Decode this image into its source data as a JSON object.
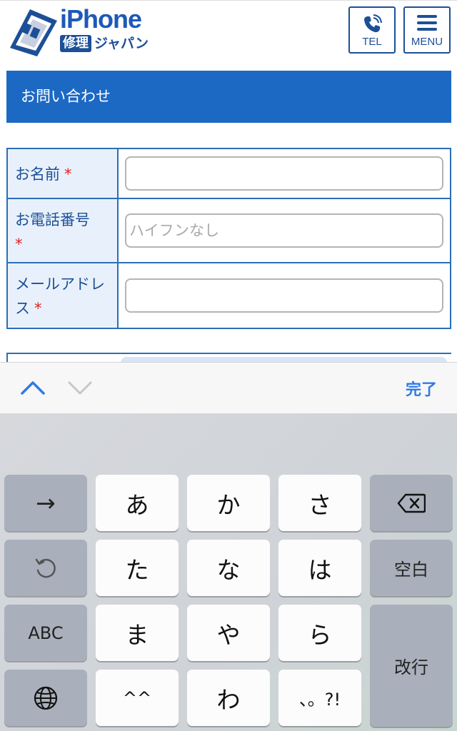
{
  "header": {
    "brand_name": "iPhone",
    "brand_badge": "修理",
    "brand_sub": "ジャパン",
    "tel_label": "TEL",
    "menu_label": "MENU",
    "colors": {
      "brand": "#1d4f97",
      "accent": "#1c69c4"
    }
  },
  "section": {
    "title": "お問い合わせ"
  },
  "form": {
    "name_label": "お名前",
    "phone_label": "お電話番号",
    "phone_placeholder": "ハイフンなし",
    "email_label": "メールアドレス",
    "required_mark": "*"
  },
  "accessory": {
    "prev_icon": "chevron-up-icon",
    "next_icon": "chevron-down-icon",
    "done_label": "完了"
  },
  "keyboard": {
    "arrow": "→",
    "undo_icon": "undo-icon",
    "abc": "ABC",
    "globe_icon": "globe-icon",
    "k_a": "あ",
    "k_ka": "か",
    "k_sa": "さ",
    "k_ta": "た",
    "k_na": "な",
    "k_ha": "は",
    "k_ma": "ま",
    "k_ya": "や",
    "k_ra": "ら",
    "k_kao": "^^",
    "k_wa": "わ",
    "k_punct": "、。?!",
    "delete_icon": "delete-icon",
    "space": "空白",
    "enter": "改行"
  }
}
